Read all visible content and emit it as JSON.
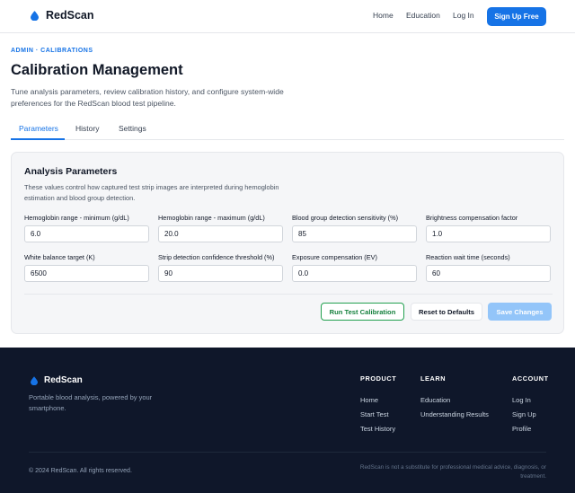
{
  "header": {
    "brand": "RedScan",
    "nav": {
      "home": "Home",
      "education": "Education",
      "login": "Log In"
    },
    "signup_label": "Sign Up Free"
  },
  "page": {
    "breadcrumb": "ADMIN · CALIBRATIONS",
    "title": "Calibration Management",
    "description": "Tune analysis parameters, review calibration history, and configure system-wide preferences for the RedScan blood test pipeline."
  },
  "tabs": [
    {
      "label": "Parameters",
      "active": true
    },
    {
      "label": "History",
      "active": false
    },
    {
      "label": "Settings",
      "active": false
    }
  ],
  "card": {
    "title": "Analysis Parameters",
    "description": "These values control how captured test strip images are interpreted during hemoglobin estimation and blood group detection.",
    "fields": [
      {
        "label": "Hemoglobin range - minimum (g/dL)",
        "value": "6.0"
      },
      {
        "label": "Hemoglobin range - maximum (g/dL)",
        "value": "20.0"
      },
      {
        "label": "Blood group detection sensitivity (%)",
        "value": "85"
      },
      {
        "label": "Brightness compensation factor",
        "value": "1.0"
      },
      {
        "label": "White balance target (K)",
        "value": "6500"
      },
      {
        "label": "Strip detection confidence threshold (%)",
        "value": "90"
      },
      {
        "label": "Exposure compensation (EV)",
        "value": "0.0"
      },
      {
        "label": "Reaction wait time (seconds)",
        "value": "60"
      }
    ],
    "buttons": {
      "run": "Run Test Calibration",
      "reset": "Reset to Defaults",
      "save": "Save Changes"
    }
  },
  "footer": {
    "brand": "RedScan",
    "tagline": "Portable blood analysis, powered by your smartphone.",
    "columns": [
      {
        "heading": "PRODUCT",
        "links": [
          "Home",
          "Start Test",
          "Test History"
        ]
      },
      {
        "heading": "LEARN",
        "links": [
          "Education",
          "Understanding Results"
        ]
      },
      {
        "heading": "ACCOUNT",
        "links": [
          "Log In",
          "Sign Up",
          "Profile"
        ]
      }
    ],
    "copyright": "© 2024 RedScan. All rights reserved.",
    "disclaimer": "RedScan is not a substitute for professional medical advice, diagnosis, or treatment."
  },
  "colors": {
    "accent": "#1673e6",
    "brand_drop": "#1673e6",
    "run_button_border": "#22a04f",
    "save_button_disabled": "#93c5f9",
    "footer_bg": "#0f172a"
  },
  "icons": {
    "brand": "blood-drop-icon"
  }
}
